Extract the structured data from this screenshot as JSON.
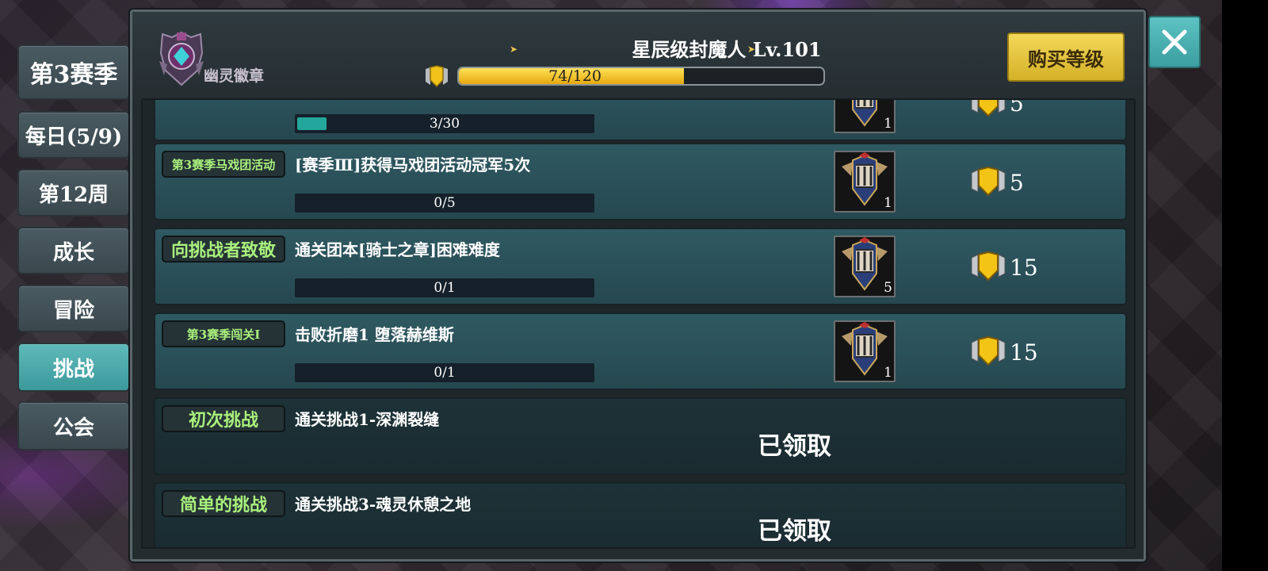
{
  "sidebar": {
    "season_label": "第3赛季",
    "tabs": [
      {
        "label": "每日(5/9)",
        "active": false
      },
      {
        "label": "第12周",
        "active": false
      },
      {
        "label": "成长",
        "active": false
      },
      {
        "label": "冒险",
        "active": false
      },
      {
        "label": "挑战",
        "active": true
      },
      {
        "label": "公会",
        "active": false
      }
    ]
  },
  "header": {
    "emblem_label": "幽灵徽章",
    "rank_title": "星辰级封魔人  Lv.101",
    "xp": {
      "current": 74,
      "max": 120,
      "text": "74/120"
    },
    "buy_level_label": "购买等级"
  },
  "tasks": [
    {
      "tag": "",
      "description": "",
      "progress_text": "3/30",
      "progress": 0.1,
      "item_count": "1",
      "reward": "5",
      "claimed": false
    },
    {
      "tag": "第3赛季马戏团活动",
      "description": "[赛季Ⅲ]获得马戏团活动冠军5次",
      "progress_text": "0/5",
      "progress": 0,
      "item_count": "1",
      "reward": "5",
      "claimed": false
    },
    {
      "tag": "向挑战者致敬",
      "description": "通关团本[骑士之章]困难难度",
      "progress_text": "0/1",
      "progress": 0,
      "item_count": "5",
      "reward": "15",
      "claimed": false
    },
    {
      "tag": "第3赛季闯关Ⅰ",
      "description": "击败折磨1  堕落赫维斯",
      "progress_text": "0/1",
      "progress": 0,
      "item_count": "1",
      "reward": "15",
      "claimed": false
    },
    {
      "tag": "初次挑战",
      "description": "通关挑战1-深渊裂缝",
      "claimed": true,
      "claimed_label": "已领取"
    },
    {
      "tag": "简单的挑战",
      "description": "通关挑战3-魂灵休憩之地",
      "claimed": true,
      "claimed_label": "已领取"
    }
  ],
  "colors": {
    "accent_teal": "#3c9a9c",
    "gold": "#e6b91a",
    "tag_green": "#a9f07c"
  }
}
